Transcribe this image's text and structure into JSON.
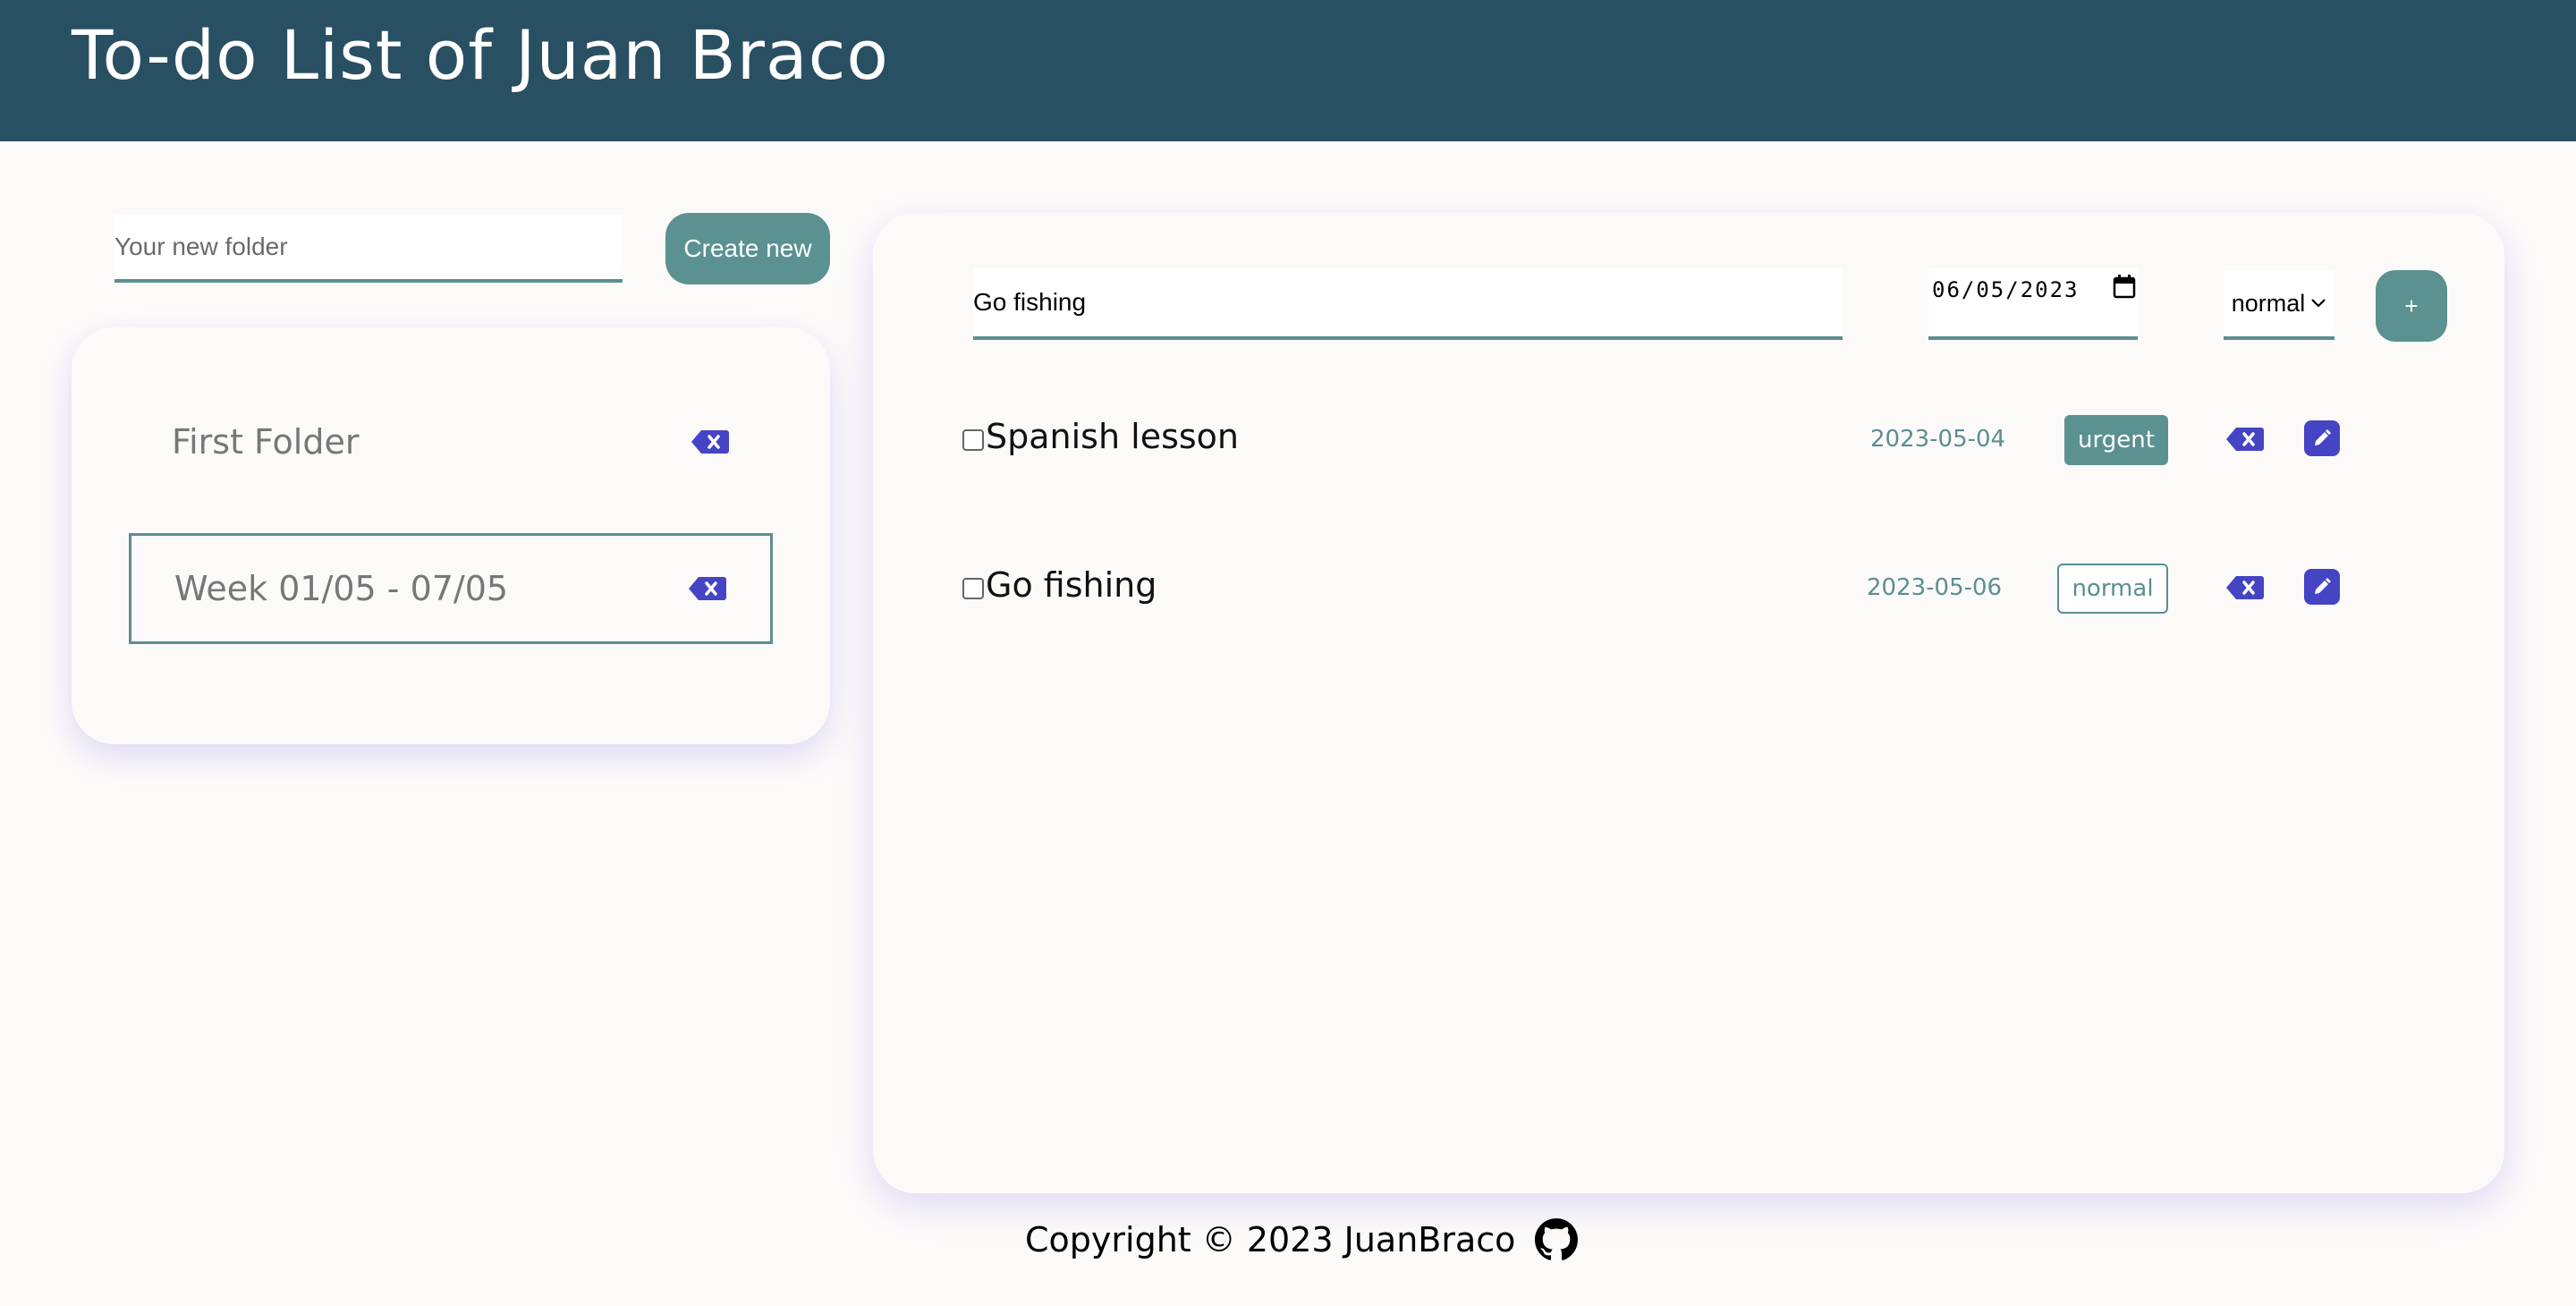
{
  "header": {
    "title": "To-do List of Juan Braco"
  },
  "folders": {
    "new_folder_placeholder": "Your new folder",
    "create_button_label": "Create new",
    "items": [
      {
        "name": "First Folder",
        "active": false
      },
      {
        "name": "Week 01/05 - 07/05",
        "active": true
      }
    ]
  },
  "task_form": {
    "title_value": "Go fishing",
    "date_value": "06/05/2023",
    "priority_value": "normal",
    "add_button_label": "+"
  },
  "tasks": [
    {
      "title": "Spanish lesson",
      "date": "2023-05-04",
      "priority": "urgent",
      "done": false
    },
    {
      "title": "Go fishing",
      "date": "2023-05-06",
      "priority": "normal",
      "done": false
    }
  ],
  "footer": {
    "copyright": "Copyright © 2023 JuanBraco",
    "icon": "github-icon"
  },
  "colors": {
    "header_bg": "#294f63",
    "accent": "#5b9191",
    "action_purple": "#4544c4",
    "page_bg": "#fcfaf9"
  }
}
